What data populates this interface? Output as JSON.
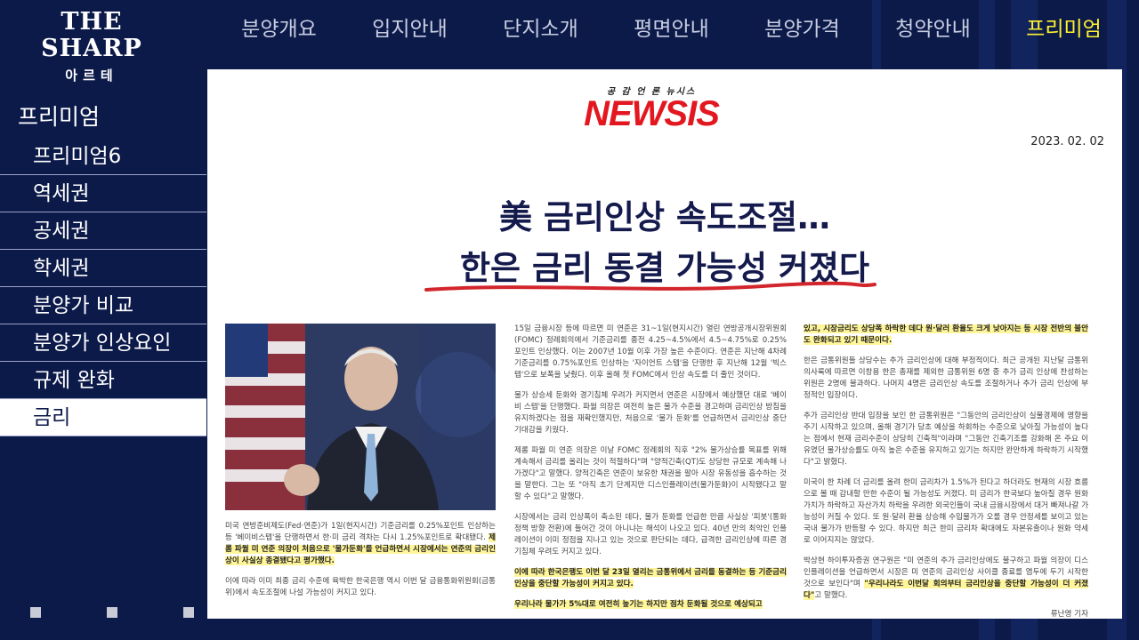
{
  "logo": {
    "main": "THE SHARP",
    "sub": "아르테"
  },
  "topnav": [
    {
      "label": "분양개요",
      "active": false
    },
    {
      "label": "입지안내",
      "active": false
    },
    {
      "label": "단지소개",
      "active": false
    },
    {
      "label": "평면안내",
      "active": false
    },
    {
      "label": "분양가격",
      "active": false
    },
    {
      "label": "청약안내",
      "active": false
    },
    {
      "label": "프리미엄",
      "active": true
    }
  ],
  "sidebar": {
    "title": "프리미엄",
    "items": [
      {
        "label": "프리미엄6",
        "active": false
      },
      {
        "label": "역세권",
        "active": false
      },
      {
        "label": "공세권",
        "active": false
      },
      {
        "label": "학세권",
        "active": false
      },
      {
        "label": "분양가 비교",
        "active": false
      },
      {
        "label": "분양가 인상요인",
        "active": false
      },
      {
        "label": "규제 완화",
        "active": false
      },
      {
        "label": "금리",
        "active": true
      }
    ]
  },
  "article": {
    "source_tag": "공 감 언 론 뉴시스",
    "source_logo": "NEWSIS",
    "date": "2023. 02. 02",
    "headline_line1": "美 금리인상 속도조절…",
    "headline_line2": "한은 금리 동결 가능성 커졌다",
    "col1": {
      "p1": "미국 연방준비제도(Fed·연준)가 1일(현지시간) 기준금리를 0.25%포인트 인상하는 등 '베이비스텝'을 단행하면서 한·미 금리 격차는 다시 1.25%포인트로 확대됐다.",
      "p1_hl": "제롬 파월 미 연준 의장이 처음으로 '물가둔화'를 언급하면서 시장에서는 연준의 금리인상이 사실상 종결됐다고 평가했다.",
      "p2": "이에 따라 이미 최종 금리 수준에 육박한 한국은행 역시 이번 달 금융통화위원회(금통위)에서 속도조절에 나설 가능성이 커지고 있다."
    },
    "col2": {
      "p1": "15일 금융시장 등에 따르면 미 연준은 31~1일(현지시간) 열린 연방공개시장위원회(FOMC) 정례회의에서 기준금리를 종전 4.25~4.5%에서 4.5~4.75%로 0.25% 포인트 인상했다. 이는 2007년 10월 이후 가장 높은 수준이다. 연준은 지난해 4차례 기준금리를 0.75%포인트 인상하는 '자이언트 스텝'을 단행한 후 지난해 12월 '빅스텝'으로 보폭을 낮췄다. 이후 올해 첫 FOMC에서 인상 속도를 더 줄인 것이다.",
      "p2": "물가 상승세 둔화와 경기침체 우려가 커지면서 연준은 시장에서 예상했던 대로 '베이비 스텝'을 단행했다. 파월 의장은 여전히 높은 물가 수준을 경고하며 금리인상 방침을 유지하겠다는 점을 재확인했지만, 처음으로 '물가 둔화'를 언급하면서 금리인상 중단 기대감을 키웠다.",
      "p3": "제롬 파월 미 연준 의장은 이날 FOMC 정례회의 직후 \"2% 물가상승률 목표를 위해 계속해서 금리를 올리는 것이 적절하다\"며 \"양적긴축(QT)도 상당한 규모로 계속해 나가겠다\"고 말했다. 양적긴축은 연준이 보유한 채권을 팔아 시장 유동성을 흡수하는 것을 말한다. 그는 또 \"아직 초기 단계지만 디스인플레이션(물가둔화)이 시작됐다고 말할 수 있다\"고 말했다.",
      "p4": "시장에서는 금리 인상폭이 축소된 데다, 물가 둔화를 언급한 만큼 사실상 '피봇'(통화정책 방향 전환)에 들어간 것이 아니냐는 해석이 나오고 있다. 40년 만의 최악인 인플레이션이 이미 정점을 지나고 있는 것으로 판단되는 데다, 급격한 금리인상에 따른 경기침체 우려도 커지고 있다.",
      "p5_hl": "이에 따라 한국은행도 이번 달 23일 열리는 금통위에서 금리를 동결하는 등 기준금리 인상을 중단할 가능성이 커지고 있다.",
      "p6_hl": "우리나라 물가가 5%대로 여전히 높기는 하지만 점차 둔화될 것으로 예상되고"
    },
    "col3": {
      "p1_hl": "있고, 시장금리도 상당폭 하락한 데다 원·달러 환율도 크게 낮아지는 등 시장 전반의 불안도 완화되고 있기 때문이다.",
      "p2": "한은 금통위원들 상당수는 추가 금리인상에 대해 부정적이다. 최근 공개된 지난달 금통위 의사록에 따르면 이창용 한은 총재를 제외한 금통위원 6명 중 추가 금리 인상에 찬성하는 위원은 2명에 불과하다. 나머지 4명은 금리인상 속도를 조절하거나 추가 금리 인상에 부정적인 입장이다.",
      "p3": "추가 금리인상 반대 입장을 보인 한 금통위원은 \"그동안의 금리인상이 실물경제에 영향을 주기 시작하고 있으며, 올해 경기가 당초 예상을 하회하는 수준으로 낮아질 가능성이 높다는 점에서 현재 금리수준이 상당히 긴축적\"이라며 \"그동안 긴축기조를 강화해 온 주요 이유였던 물가상승률도 아직 높은 수준을 유지하고 있기는 하지만 완만하게 하락하기 시작했다\"고 밝혔다.",
      "p4": "미국이 한 차례 더 금리를 올려 한미 금리차가 1.5%가 된다고 하더라도 현재의 시장 흐름으로 볼 때 감내할 만한 수준이 될 가능성도 커졌다. 미 금리가 한국보다 높아질 경우 원화 가치가 하락하고 자산가치 하락을 우려한 외국인들이 국내 금융시장에서 대거 빠져나갈 가능성이 커질 수 있다. 또 원·달러 환율 상승해 수입물가가 오를 경우 안정세를 보이고 있는 국내 물가가 반등할 수 있다. 하지만 최근 한미 금리차 확대에도 자본유출이나 원화 약세로 이어지지는 않았다.",
      "p5": "박상현 하이투자증권 연구원은 \"미 연준의 추가 금리인상에도 불구하고 파월 의장이 디스인플레이션을 언급하면서 시장은 미 연준의 금리인상 사이클 종료를 염두에 두기 시작한 것으로 보인다\"며",
      "p5_hl": "\"우리나라도 이번달 회의부터 금리인상을 중단할 가능성이 더 커졌다\"",
      "p5_end": "고 말했다.",
      "reporter": "류난영 기자"
    }
  },
  "colors": {
    "background": "#0c1a4a",
    "active_nav": "#fff22e",
    "newsis_red": "#e3171f",
    "highlight": "#fff59a"
  }
}
